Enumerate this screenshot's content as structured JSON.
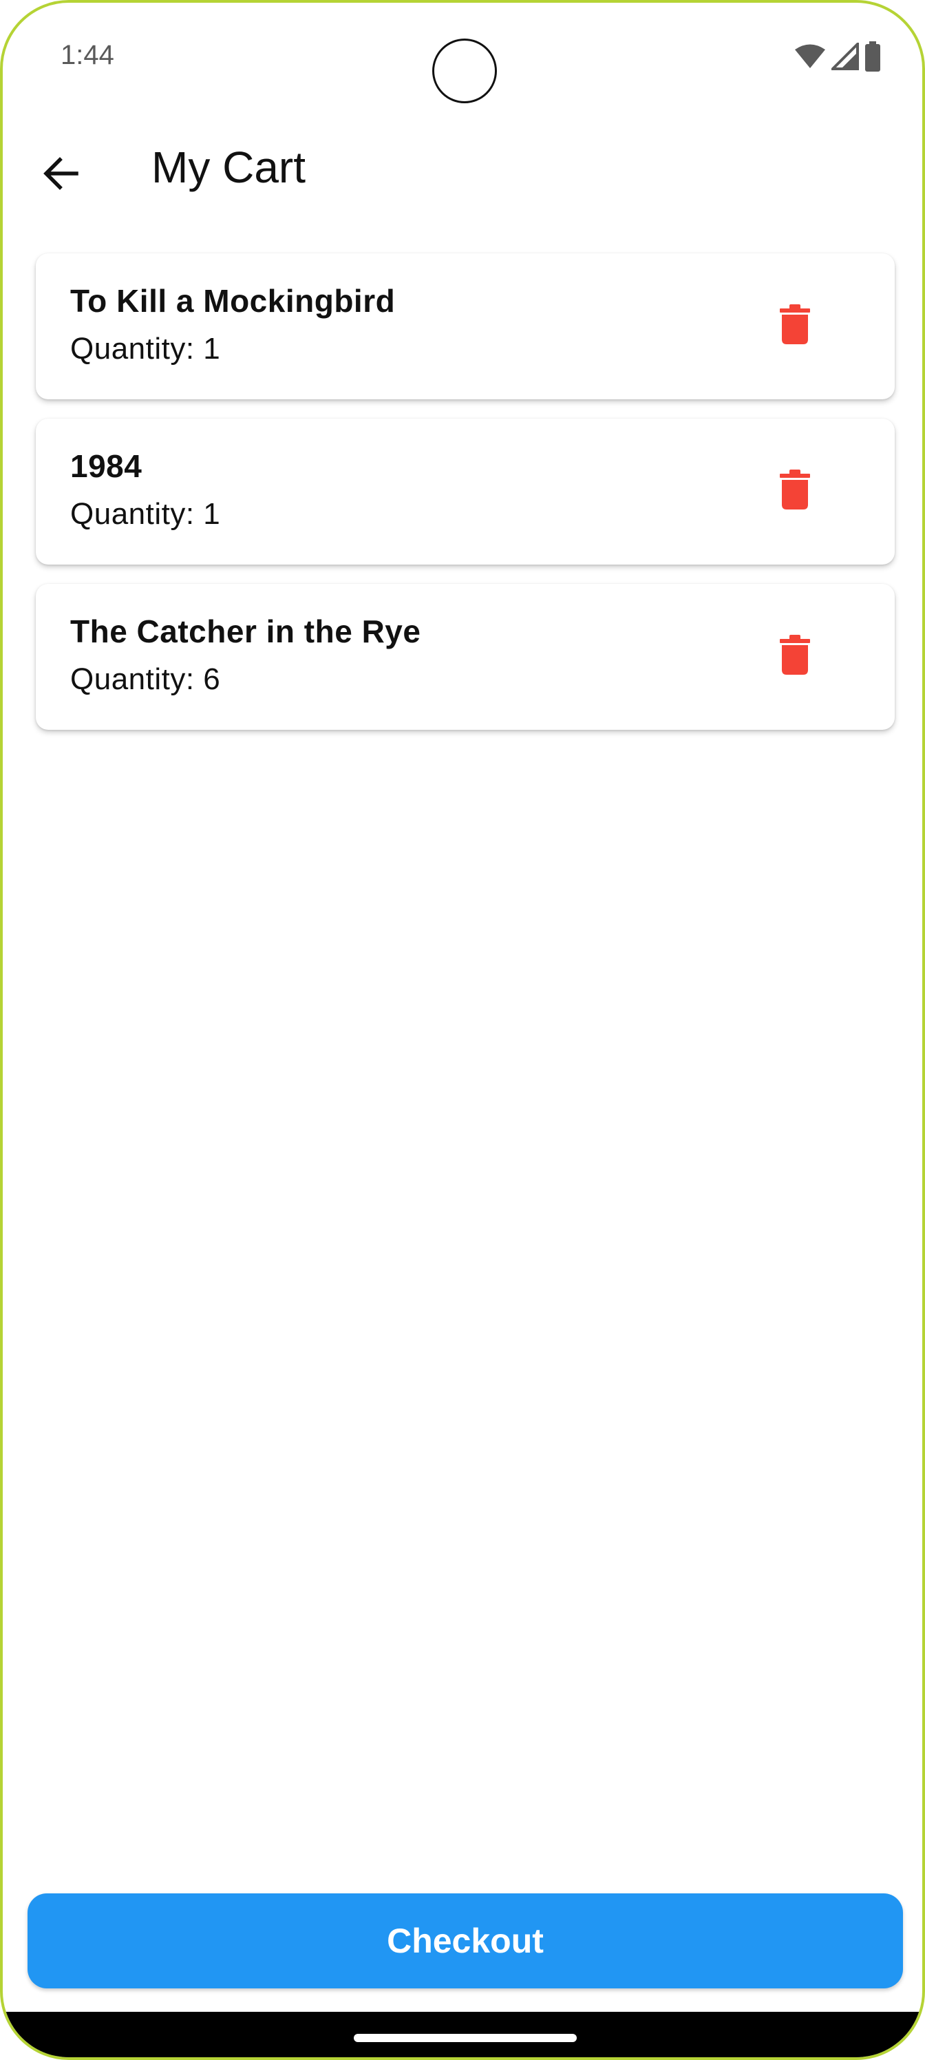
{
  "status_bar": {
    "time": "1:44",
    "icons": [
      "wifi-icon",
      "signal-icon",
      "battery-icon"
    ]
  },
  "app_bar": {
    "back_icon": "arrow-left-icon",
    "title": "My Cart"
  },
  "cart": {
    "items": [
      {
        "title": "To Kill a Mockingbird",
        "quantity_text": "Quantity: 1",
        "delete_icon": "trash-icon"
      },
      {
        "title": "1984",
        "quantity_text": "Quantity: 1",
        "delete_icon": "trash-icon"
      },
      {
        "title": "The Catcher in the Rye",
        "quantity_text": "Quantity: 6",
        "delete_icon": "trash-icon"
      }
    ]
  },
  "footer": {
    "checkout_label": "Checkout"
  },
  "colors": {
    "accent": "#2196f3",
    "delete": "#f44336",
    "frame": "#b5d335"
  }
}
